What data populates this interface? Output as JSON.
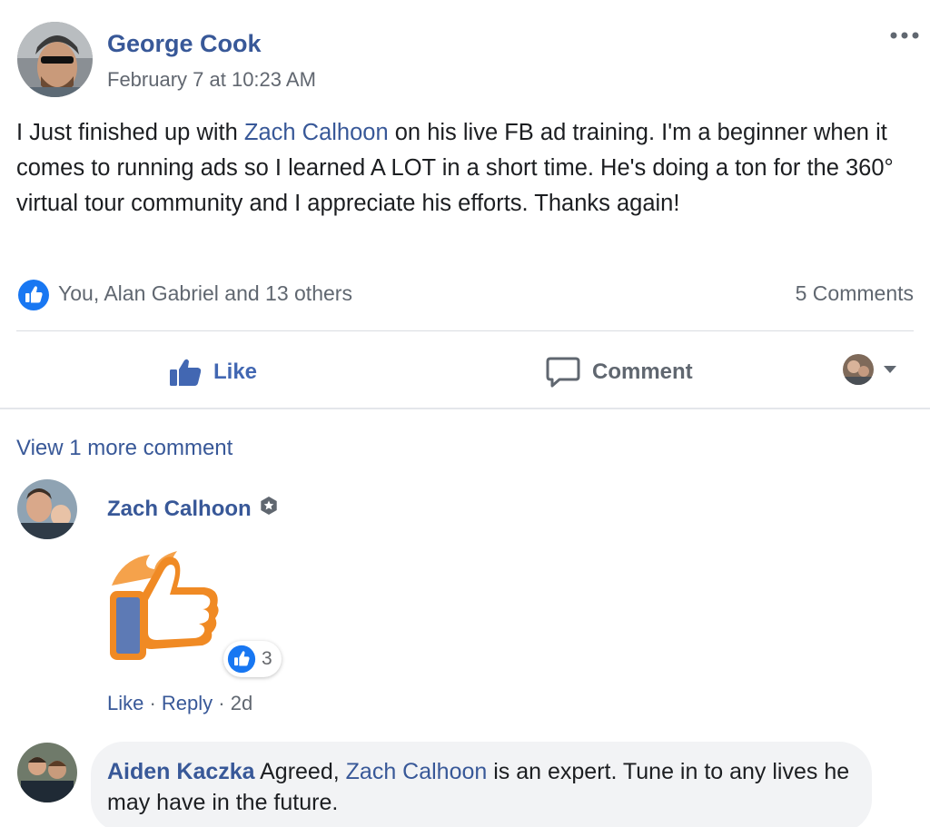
{
  "post": {
    "author": "George Cook",
    "time": "February 7 at 10:23 AM",
    "text_before": "I Just finished up with ",
    "mention": "Zach Calhoon",
    "text_after": " on his live FB ad training. I'm a beginner when it comes to running ads so I learned A LOT in a short time. He's doing a ton for the 360° virtual tour community and I appreciate his efforts. Thanks again!",
    "reactors": "You, Alan Gabriel and 13 others",
    "comments_count": "5 Comments"
  },
  "actions": {
    "like": "Like",
    "comment": "Comment"
  },
  "view_more": "View 1 more comment",
  "comment1": {
    "author": "Zach Calhoon",
    "reaction_count": "3",
    "like": "Like",
    "sep1": " · ",
    "reply": "Reply",
    "sep2": " · ",
    "age": "2d"
  },
  "comment2": {
    "author": "Aiden Kaczka",
    "text_before": " Agreed, ",
    "mention": "Zach Calhoon",
    "text_after": " is an expert. Tune in to any lives he may have in the future."
  },
  "colors": {
    "link": "#385898",
    "like_blue": "#4267b2",
    "sticker_orange": "#f08a24"
  },
  "icons": [
    "more-icon",
    "like-bubble-icon",
    "thumbs-up-icon",
    "comment-icon",
    "caret-down-icon",
    "admin-badge-icon",
    "fire-like-sticker"
  ]
}
